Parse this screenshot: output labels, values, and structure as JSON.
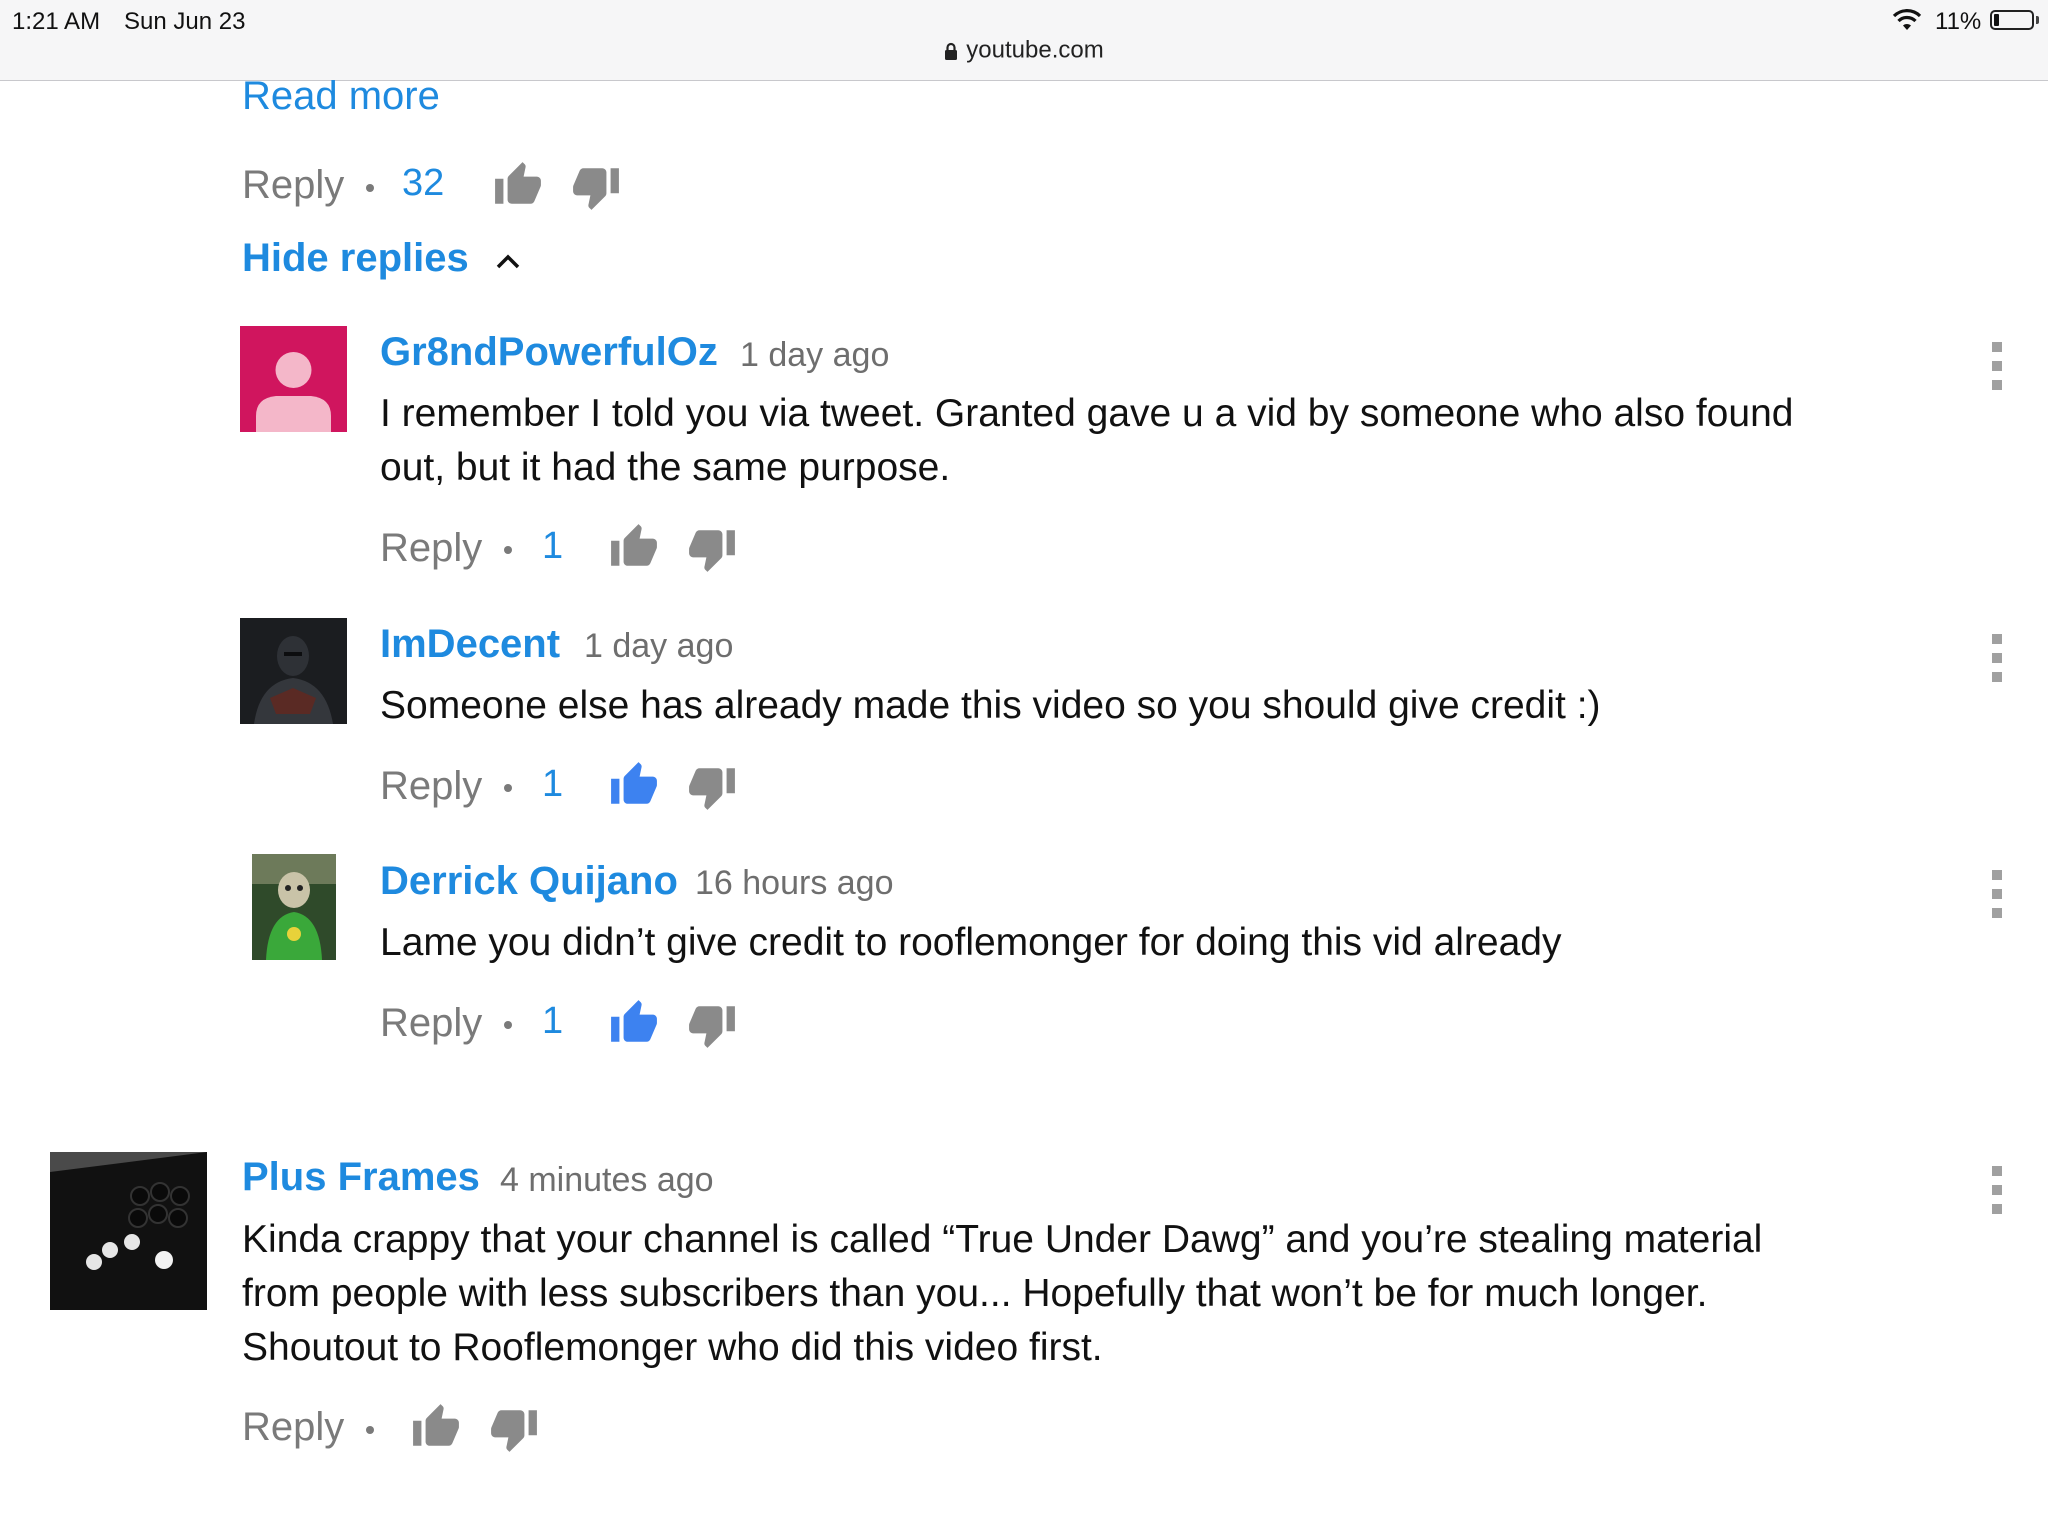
{
  "status_bar": {
    "time": "1:21 AM",
    "date": "Sun Jun 23",
    "battery": "11%",
    "url": "youtube.com"
  },
  "parent_actions": {
    "read_more": "Read more",
    "reply": "Reply",
    "likes": "32",
    "hide_replies": "Hide replies"
  },
  "replies": [
    {
      "author": "Gr8ndPowerfulOz",
      "time": "1 day ago",
      "text_line1": "I remember I told you via tweet. Granted gave u a vid by someone who also found",
      "text_line2": "out, but it had the same purpose.",
      "reply": "Reply",
      "likes": "1",
      "liked": false
    },
    {
      "author": "ImDecent",
      "time": "1 day ago",
      "text_line1": "Someone else has already made this video so you should give credit :)",
      "reply": "Reply",
      "likes": "1",
      "liked": true
    },
    {
      "author": "Derrick Quijano",
      "time": "16 hours ago",
      "text_line1": "Lame you didn’t give credit to rooflemonger for doing this vid already",
      "reply": "Reply",
      "likes": "1",
      "liked": true
    }
  ],
  "comment": {
    "author": "Plus Frames",
    "time": "4 minutes ago",
    "text_line1": "Kinda crappy that your channel is called “True Under Dawg” and you’re stealing material",
    "text_line2": "from people with less subscribers than you... Hopefully that won’t be for much longer.",
    "text_line3": "Shoutout to Rooflemonger who did this video first.",
    "reply": "Reply"
  },
  "colors": {
    "link_blue": "#1e8adf",
    "liked_blue": "#3d82f0",
    "icon_gray": "#8a8a8a",
    "avatar_magenta": "#d0155e"
  }
}
